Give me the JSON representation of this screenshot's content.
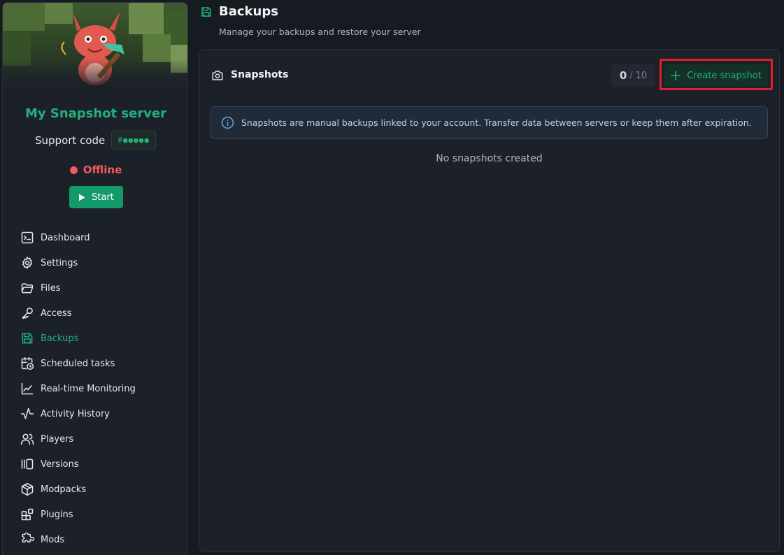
{
  "sidebar": {
    "server_name": "My Snapshot server",
    "support_label": "Support code",
    "support_code": "#●●●●●",
    "status": "Offline",
    "start_label": "Start",
    "items": [
      {
        "label": "Dashboard",
        "icon": "terminal-icon",
        "active": false
      },
      {
        "label": "Settings",
        "icon": "gear-icon",
        "active": false
      },
      {
        "label": "Files",
        "icon": "folder-icon",
        "active": false
      },
      {
        "label": "Access",
        "icon": "key-icon",
        "active": false
      },
      {
        "label": "Backups",
        "icon": "save-icon",
        "active": true
      },
      {
        "label": "Scheduled tasks",
        "icon": "calendar-clock-icon",
        "active": false
      },
      {
        "label": "Real-time Monitoring",
        "icon": "line-chart-icon",
        "active": false
      },
      {
        "label": "Activity History",
        "icon": "activity-icon",
        "active": false
      },
      {
        "label": "Players",
        "icon": "users-icon",
        "active": false
      },
      {
        "label": "Versions",
        "icon": "versions-icon",
        "active": false
      },
      {
        "label": "Modpacks",
        "icon": "package-icon",
        "active": false
      },
      {
        "label": "Plugins",
        "icon": "blocks-icon",
        "active": false
      },
      {
        "label": "Mods",
        "icon": "puzzle-icon",
        "active": false
      }
    ]
  },
  "header": {
    "title": "Backups",
    "subtitle": "Manage your backups and restore your server"
  },
  "snapshots": {
    "title": "Snapshots",
    "count": "0",
    "separator": "/",
    "max": "10",
    "create_label": "Create snapshot",
    "info": "Snapshots are manual backups linked to your account. Transfer data between servers or keep them after expiration.",
    "empty": "No snapshots created"
  },
  "colors": {
    "accent": "#22b07d",
    "offline": "#ef5a5a",
    "highlight": "#e0212b",
    "background": "#161a21",
    "panel": "#1c2029"
  }
}
